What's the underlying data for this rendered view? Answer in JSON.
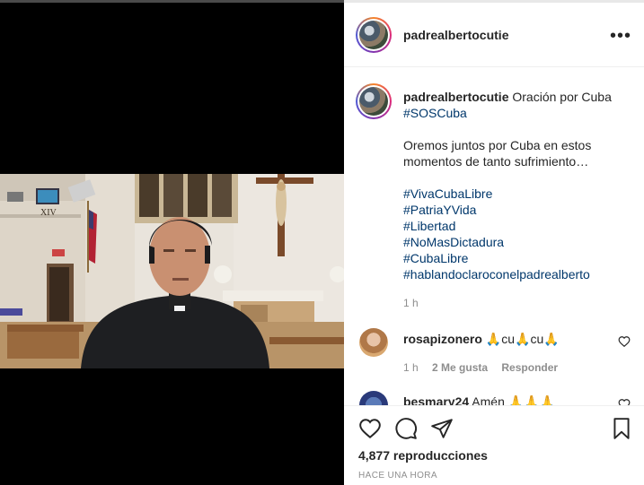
{
  "post": {
    "username": "padrealbertocutie",
    "views": "4,877 reproducciones",
    "posted": "HACE UNA HORA"
  },
  "caption": {
    "username": "padrealbertocutie",
    "title": "Oración por Cuba",
    "hashtag1": "#SOSCuba",
    "text": "Oremos juntos por Cuba en estos momentos de tanto sufrimiento…",
    "hashtags": [
      "#VivaCubaLibre",
      "#PatriaYVida",
      "#Libertad",
      "#NoMasDictadura",
      "#CubaLibre",
      "#hablandoclaroconelpadrealberto"
    ],
    "time": "1 h"
  },
  "comments": [
    {
      "username": "rosapizonero",
      "text": "🙏cu🙏cu🙏",
      "time": "1 h",
      "likes": "2 Me gusta",
      "reply": "Responder"
    },
    {
      "username": "besmary24",
      "text": "Amén 🙏🙏🙏"
    }
  ],
  "video_sign": "XIV",
  "icons": {
    "more": "more-horizontal-icon",
    "like": "heart-icon",
    "comment": "comment-bubble-icon",
    "share": "paper-plane-icon",
    "save": "bookmark-icon"
  },
  "colors": {
    "hashtag": "#00376b",
    "text": "#262626",
    "muted": "#8e8e8e"
  }
}
